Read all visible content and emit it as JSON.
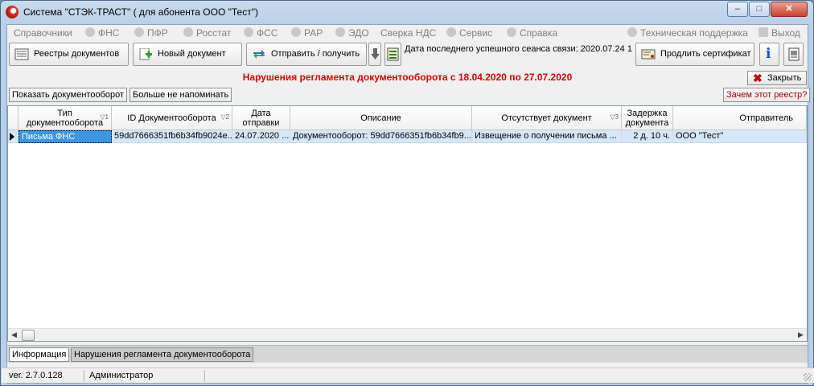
{
  "window": {
    "title": "Система \"СТЭК-ТРАСТ\" ( для абонента ООО \"Тест\")",
    "minimize": "‒",
    "maximize": "□",
    "close": "✕"
  },
  "menu": {
    "items": [
      {
        "label": "Справочники"
      },
      {
        "label": "ФНС"
      },
      {
        "label": "ПФР"
      },
      {
        "label": "Росстат"
      },
      {
        "label": "ФСС"
      },
      {
        "label": "РАР"
      },
      {
        "label": "ЭДО"
      },
      {
        "label": "Сверка НДС"
      },
      {
        "label": "Сервис"
      },
      {
        "label": "Справка"
      }
    ],
    "support": "Техническая поддержка",
    "exit": "Выход"
  },
  "toolbar": {
    "registries": "Реестры документов",
    "new_doc": "Новый документ",
    "send_receive": "Отправить / получить",
    "session": "Дата последнего успешного сеанса связи: 2020.07.24 1",
    "renew": "Продлить сертификат",
    "info_glyph": "i"
  },
  "banner": {
    "text": "Нарушения регламента документооборота с 18.04.2020 по 27.07.2020",
    "close": "Закрыть"
  },
  "actions": {
    "show": "Показать документооборот",
    "no_remind": "Больше не напоминать",
    "why": "Зачем этот реестр?"
  },
  "table": {
    "headers": [
      {
        "label": "Тип документооборота",
        "sort": "▽1"
      },
      {
        "label": "ID Документооборота",
        "sort": "▽2"
      },
      {
        "label": "Дата отправки",
        "sort": ""
      },
      {
        "label": "Описание",
        "sort": ""
      },
      {
        "label": "Отсутствует документ",
        "sort": "▽3"
      },
      {
        "label": "Задержка документа",
        "sort": ""
      },
      {
        "label": "Отправитель",
        "sort": ""
      }
    ],
    "rows": [
      [
        "Письма ФНС",
        "59dd7666351fb6b34fb9024e...",
        "24.07.2020 ...",
        "Документооборот: 59dd7666351fb6b34fb9...",
        "Извещение о получении письма ...",
        "2 д. 10 ч.",
        "ООО \"Тест\""
      ]
    ]
  },
  "tabs": {
    "info": "Информация",
    "violations": "Нарушения регламента документооборота"
  },
  "status": {
    "version": "ver. 2.7.0.128",
    "user": "Администратор"
  }
}
